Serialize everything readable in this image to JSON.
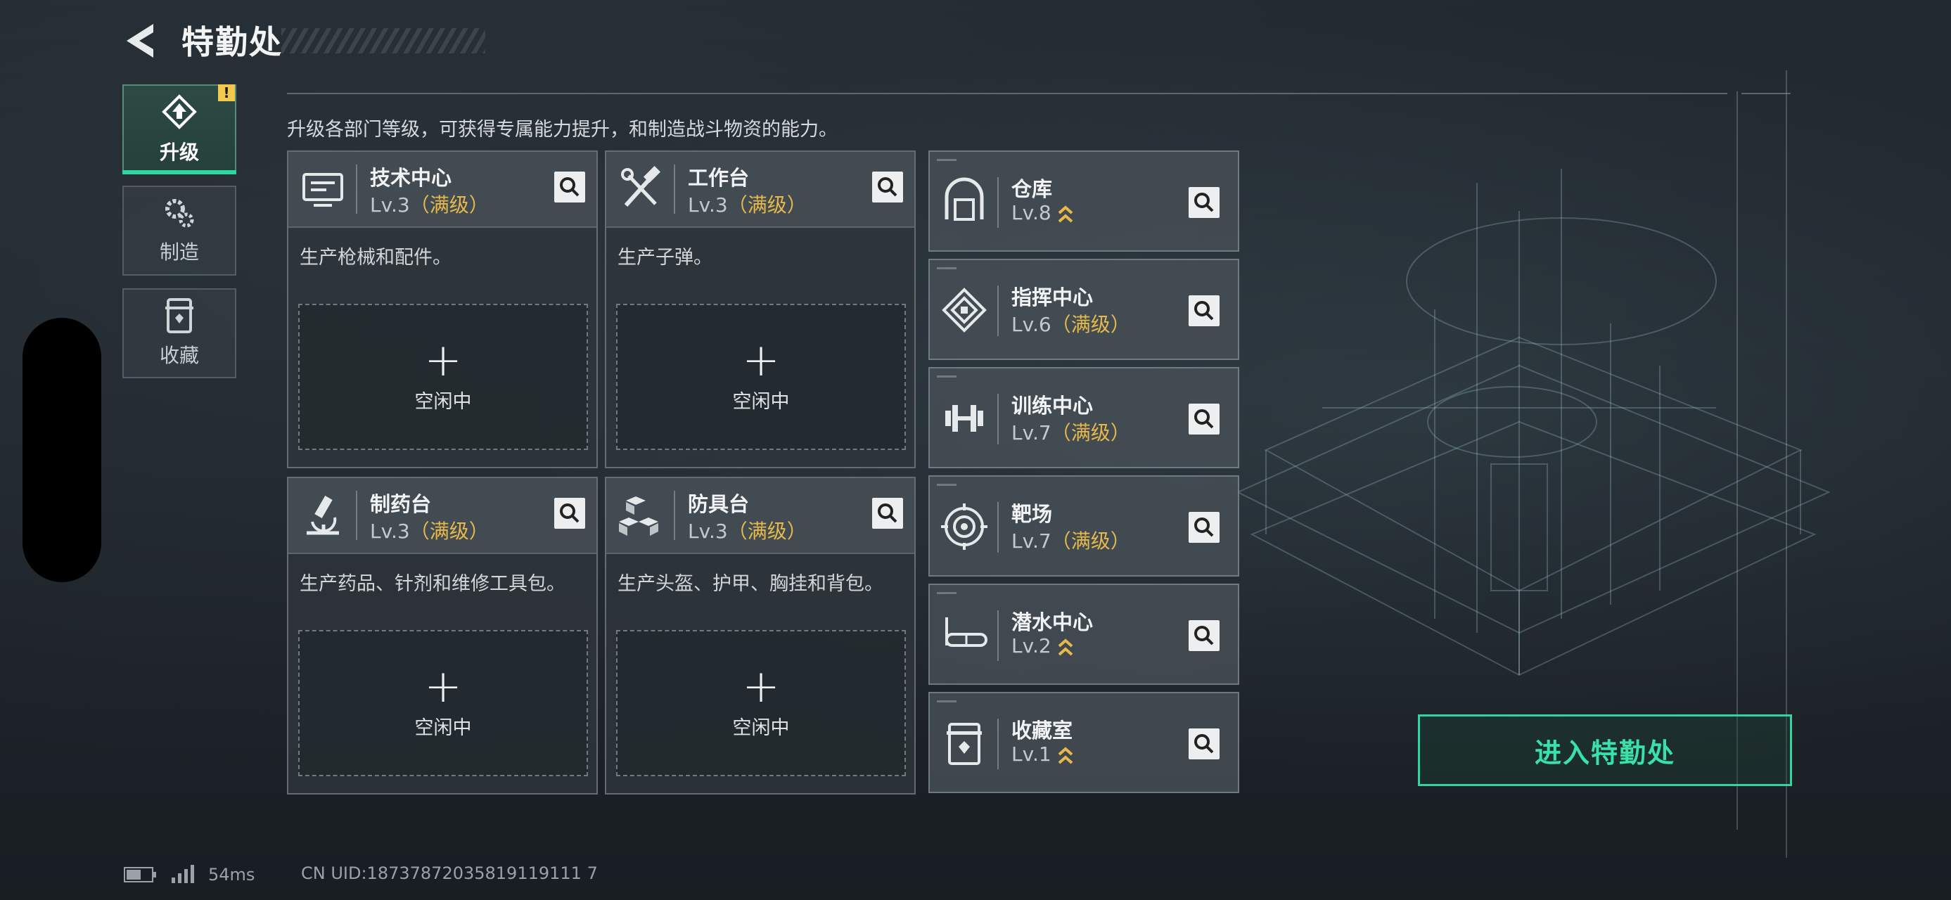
{
  "header": {
    "title": "特勤处",
    "back_icon": "back-arrow-icon"
  },
  "sidebar": {
    "tabs": [
      {
        "label": "升级",
        "icon": "upgrade-icon",
        "active": true,
        "alert": "!"
      },
      {
        "label": "制造",
        "icon": "gear-cluster-icon",
        "active": false
      },
      {
        "label": "收藏",
        "icon": "collection-icon",
        "active": false
      }
    ]
  },
  "description": "升级各部门等级，可获得专属能力提升，和制造战斗物资的能力。",
  "big_cards": [
    {
      "name": "技术中心",
      "level": "Lv.3",
      "max_tag": "（满级）",
      "desc": "生产枪械和配件。",
      "slot_label": "空闲中",
      "slot_plus": "+",
      "icon": "tech-center-icon"
    },
    {
      "name": "工作台",
      "level": "Lv.3",
      "max_tag": "（满级）",
      "desc": "生产子弹。",
      "slot_label": "空闲中",
      "slot_plus": "+",
      "icon": "workbench-tools-icon"
    },
    {
      "name": "制药台",
      "level": "Lv.3",
      "max_tag": "（满级）",
      "desc": "生产药品、针剂和维修工具包。",
      "slot_label": "空闲中",
      "slot_plus": "+",
      "icon": "microscope-icon"
    },
    {
      "name": "防具台",
      "level": "Lv.3",
      "max_tag": "（满级）",
      "desc": "生产头盔、护甲、胸挂和背包。",
      "slot_label": "空闲中",
      "slot_plus": "+",
      "icon": "armor-boxes-icon"
    }
  ],
  "small_cards": [
    {
      "name": "仓库",
      "level": "Lv.8",
      "max_tag": "",
      "upgradeable": true,
      "icon": "warehouse-icon"
    },
    {
      "name": "指挥中心",
      "level": "Lv.6",
      "max_tag": "（满级）",
      "upgradeable": false,
      "icon": "command-center-icon"
    },
    {
      "name": "训练中心",
      "level": "Lv.7",
      "max_tag": "（满级）",
      "upgradeable": false,
      "icon": "dumbbell-icon"
    },
    {
      "name": "靶场",
      "level": "Lv.7",
      "max_tag": "（满级）",
      "upgradeable": false,
      "icon": "target-icon"
    },
    {
      "name": "潜水中心",
      "level": "Lv.2",
      "max_tag": "",
      "upgradeable": true,
      "icon": "diving-mask-icon"
    },
    {
      "name": "收藏室",
      "level": "Lv.1",
      "max_tag": "",
      "upgradeable": true,
      "icon": "collection-room-icon"
    }
  ],
  "enter_button": {
    "label": "进入特勤处"
  },
  "status": {
    "ping": "54ms",
    "uid": "CN UID:18737872035819119111 7"
  },
  "colors": {
    "accent": "#2fd6a0",
    "max_level": "#e6b94a",
    "alert": "#f2c94c"
  }
}
